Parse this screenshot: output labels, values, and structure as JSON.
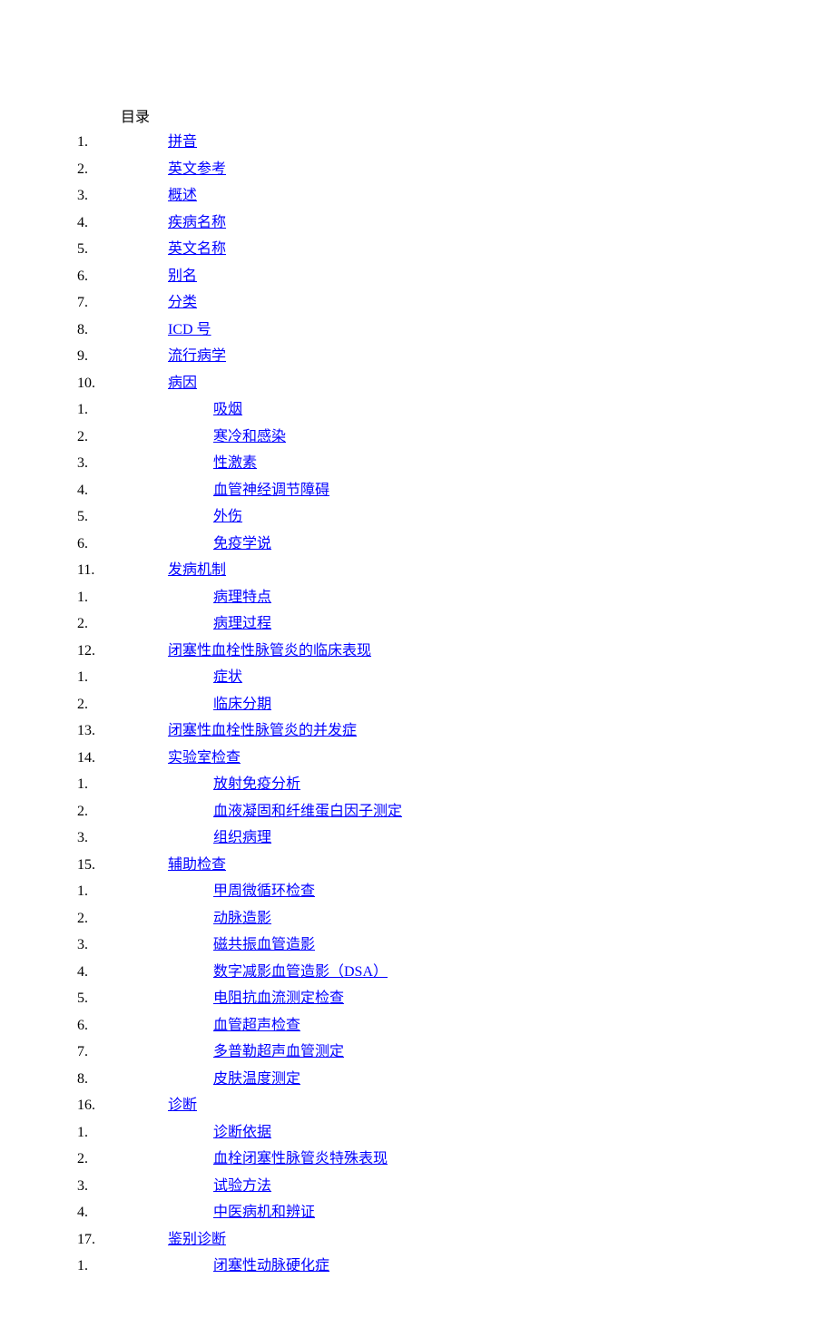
{
  "heading": "目录",
  "toc": [
    {
      "num": "1.",
      "label": "拼音",
      "level": 1
    },
    {
      "num": "2.",
      "label": "英文参考",
      "level": 1
    },
    {
      "num": "3.",
      "label": "概述",
      "level": 1
    },
    {
      "num": "4.",
      "label": "疾病名称",
      "level": 1
    },
    {
      "num": "5.",
      "label": "英文名称",
      "level": 1
    },
    {
      "num": "6.",
      "label": "别名",
      "level": 1
    },
    {
      "num": "7.",
      "label": "分类",
      "level": 1
    },
    {
      "num": "8.",
      "label": "ICD 号",
      "level": 1
    },
    {
      "num": "9.",
      "label": "流行病学",
      "level": 1
    },
    {
      "num": "10.",
      "label": "病因",
      "level": 1
    },
    {
      "num": "1.",
      "label": "吸烟",
      "level": 2
    },
    {
      "num": "2.",
      "label": "寒冷和感染",
      "level": 2
    },
    {
      "num": "3.",
      "label": "性激素",
      "level": 2
    },
    {
      "num": "4.",
      "label": "血管神经调节障碍",
      "level": 2
    },
    {
      "num": "5.",
      "label": "外伤",
      "level": 2
    },
    {
      "num": "6.",
      "label": "免疫学说",
      "level": 2
    },
    {
      "num": "11.",
      "label": "发病机制",
      "level": 1
    },
    {
      "num": "1.",
      "label": "病理特点",
      "level": 2
    },
    {
      "num": "2.",
      "label": "病理过程",
      "level": 2
    },
    {
      "num": "12.",
      "label": "闭塞性血栓性脉管炎的临床表现",
      "level": 1
    },
    {
      "num": "1.",
      "label": "症状",
      "level": 2
    },
    {
      "num": "2.",
      "label": "临床分期",
      "level": 2
    },
    {
      "num": "13.",
      "label": "闭塞性血栓性脉管炎的并发症",
      "level": 1
    },
    {
      "num": "14.",
      "label": "实验室检查",
      "level": 1
    },
    {
      "num": "1.",
      "label": "放射免疫分析",
      "level": 2
    },
    {
      "num": "2.",
      "label": "血液凝固和纤维蛋白因子测定",
      "level": 2
    },
    {
      "num": "3.",
      "label": "组织病理",
      "level": 2
    },
    {
      "num": "15.",
      "label": "辅助检查",
      "level": 1
    },
    {
      "num": "1.",
      "label": "甲周微循环检查",
      "level": 2
    },
    {
      "num": "2.",
      "label": "动脉造影",
      "level": 2
    },
    {
      "num": "3.",
      "label": "磁共振血管造影",
      "level": 2
    },
    {
      "num": "4.",
      "label": "数字减影血管造影（DSA）",
      "level": 2
    },
    {
      "num": "5.",
      "label": "电阻抗血流测定检查",
      "level": 2
    },
    {
      "num": "6.",
      "label": "血管超声检查",
      "level": 2
    },
    {
      "num": "7.",
      "label": "多普勒超声血管测定",
      "level": 2
    },
    {
      "num": "8.",
      "label": "皮肤温度测定",
      "level": 2
    },
    {
      "num": "16.",
      "label": "诊断",
      "level": 1
    },
    {
      "num": "1.",
      "label": "诊断依据",
      "level": 2
    },
    {
      "num": "2.",
      "label": "血栓闭塞性脉管炎特殊表现",
      "level": 2
    },
    {
      "num": "3.",
      "label": "试验方法",
      "level": 2
    },
    {
      "num": "4.",
      "label": "中医病机和辨证",
      "level": 2
    },
    {
      "num": "17.",
      "label": "鉴别诊断",
      "level": 1
    },
    {
      "num": "1.",
      "label": "闭塞性动脉硬化症",
      "level": 2
    }
  ]
}
